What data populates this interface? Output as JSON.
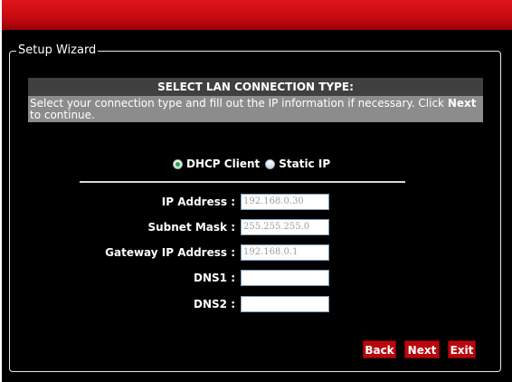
{
  "wizard": {
    "legend": "Setup Wizard",
    "header": "SELECT LAN CONNECTION TYPE:",
    "description_pre": "Select your connection type and fill out the IP information if necessary. Click ",
    "description_bold": "Next",
    "description_post": " to continue."
  },
  "connection_type": {
    "options": [
      {
        "label": "DHCP Client",
        "selected": true
      },
      {
        "label": "Static IP",
        "selected": false
      }
    ]
  },
  "fields": [
    {
      "label": "IP Address :",
      "value": "192.168.0.30"
    },
    {
      "label": "Subnet Mask :",
      "value": "255.255.255.0"
    },
    {
      "label": "Gateway IP Address :",
      "value": "192.168.0.1"
    },
    {
      "label": "DNS1 :",
      "value": ""
    },
    {
      "label": "DNS2 :",
      "value": ""
    }
  ],
  "buttons": {
    "back": "Back",
    "next": "Next",
    "exit": "Exit"
  },
  "colors": {
    "topbar": "#c40a10",
    "button": "#b8080e",
    "header_bg": "#404040",
    "desc_bg": "#8c8c8c"
  }
}
